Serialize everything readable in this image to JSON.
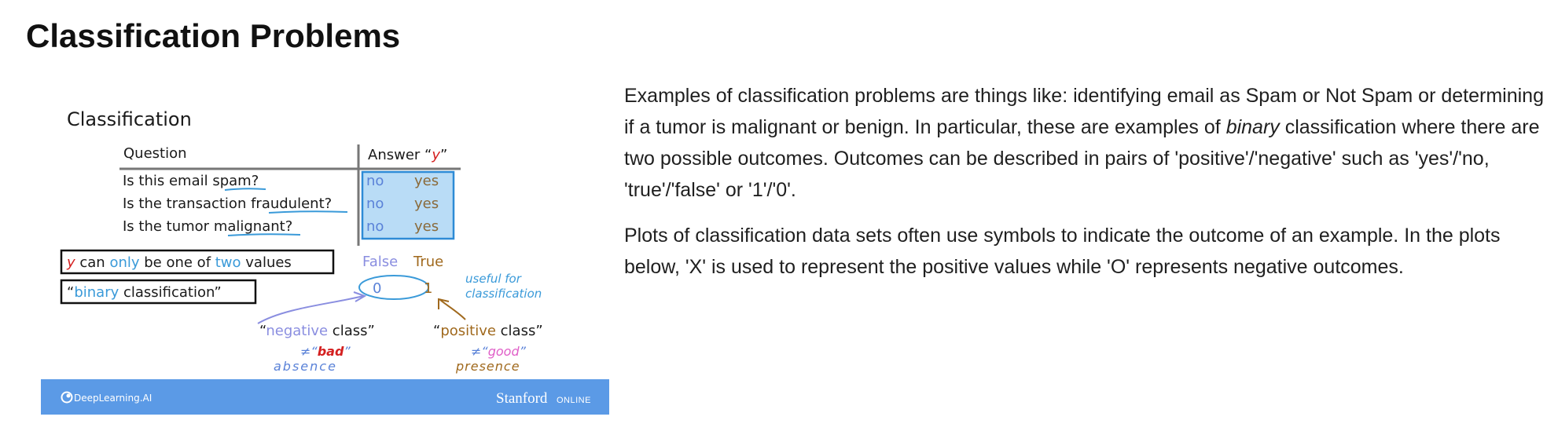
{
  "page_title": "Classification Problems",
  "slide": {
    "title": "Classification",
    "question_header": "Question",
    "answer_header_prefix": "Answer “",
    "answer_header_y": "y",
    "answer_header_suffix": "”",
    "rows": [
      {
        "pre": "Is this email ",
        "key": "spam",
        "post": "?",
        "no": "no",
        "yes": "yes"
      },
      {
        "pre": "Is the transaction ",
        "key": "fraudulent",
        "post": "?",
        "no": "no",
        "yes": "yes"
      },
      {
        "pre": "Is the tumor ",
        "key": "malignant",
        "post": "?",
        "no": "no",
        "yes": "yes"
      }
    ],
    "box1": {
      "y": "y",
      "t1": " can ",
      "only": "only",
      "t2": " be one of ",
      "two": "two",
      "t3": " values"
    },
    "box2": {
      "q1": "“",
      "binary": "binary",
      "rest": " classification”"
    },
    "false_label": "False",
    "true_label": "True",
    "zero": "0",
    "one": "1",
    "useful_line1": "useful for",
    "useful_line2": "classification",
    "neg_q1": "“",
    "neg_word": "negative",
    "neg_rest": " class”",
    "pos_q1": "“",
    "pos_word": "positive",
    "pos_rest": " class”",
    "neq": "≠",
    "bad_q1": "“",
    "bad": "bad",
    "bad_q2": "”",
    "good_q1": "“",
    "good": "good",
    "good_q2": "”",
    "absence": "absence",
    "presence": "presence",
    "footer_logo": "DeepLearning.AI",
    "footer_stanford": "Stanford",
    "footer_online": "ONLINE",
    "colors": {
      "highlight_fill": "#b9dcf6",
      "highlight_stroke": "#2e8bd6",
      "blue": "#3a9ad9",
      "purple": "#8a8ee0",
      "orange": "#a0691d",
      "red": "#d42020",
      "pink": "#e060c8",
      "footer": "#5b9ae6"
    }
  },
  "paragraphs": [
    {
      "before_italic": "Examples of classification problems are things like: identifying email as Spam or Not Spam or determining if a tumor is malignant or benign. In particular, these are examples of ",
      "italic": "binary",
      "after_italic": " classification where there are two possible outcomes. Outcomes can be described in pairs of 'positive'/'negative' such as 'yes'/'no, 'true'/'false' or '1'/'0'."
    },
    {
      "text": "Plots of classification data sets often use symbols to indicate the outcome of an example. In the plots below, 'X' is used to represent the positive values while 'O' represents negative outcomes."
    }
  ]
}
